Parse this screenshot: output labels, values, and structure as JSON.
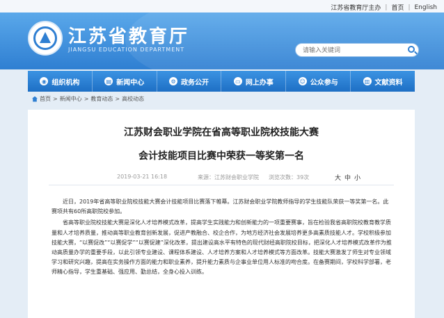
{
  "topbar": {
    "sponsor": "江苏省教育厅主办",
    "home": "首页",
    "english": "English"
  },
  "header": {
    "title": "江苏省教育厅",
    "subtitle": "JIANGSU EDUCATION DEPARTMENT",
    "search_placeholder": "请输入关键词"
  },
  "nav": [
    {
      "label": "组织机构",
      "icon": "org-icon"
    },
    {
      "label": "新闻中心",
      "icon": "news-icon"
    },
    {
      "label": "政务公开",
      "icon": "gov-icon"
    },
    {
      "label": "网上办事",
      "icon": "monitor-icon"
    },
    {
      "label": "公众参与",
      "icon": "people-icon"
    },
    {
      "label": "文献资料",
      "icon": "book-icon"
    }
  ],
  "breadcrumb": {
    "items": [
      "首页",
      "新闻中心",
      "教育动态",
      "高校动态"
    ],
    "sep": ">"
  },
  "article": {
    "title_line1": "江苏财会职业学院在省高等职业院校技能大赛",
    "title_line2": "会计技能项目比赛中荣获一等奖第一名",
    "date": "2019-03-21 16:18",
    "source": "来源：江苏财会职业学院",
    "views": "浏览次数：39次",
    "font_sizes": [
      "大",
      "中",
      "小"
    ],
    "paragraphs": [
      "近日，2019年省高等职业院校技能大赛会计技能项目比赛落下帷幕。江苏财会职业学院教师指导的学生技能队荣获一等奖第一名。此赛项共有60所高职院校参加。",
      "省高等职业院校技能大赛是深化人才培养模式改革，提高学生实践能力和创新能力的一项重要赛事，旨在检验我省高职院校教育教学质量和人才培养质量，推动高等职业教育创新发展，促进产教融合、校企合作，为地方经济社会发展培养更多高素质技能人才。学校积极参加技能大赛，“以赛促改”“以赛促学”“以赛促建”深化改革，提出建设高水平有特色的现代财经高职院校目标，把深化人才培养模式改革作为推动高质量办学的重要手段，以此引领专业建设、课程体系建设、人才培养方案和人才培养模式等方面改革。技能大赛激发了师生对专业领域学习和研究兴趣，提高在实务操作方面的能力和职业素养，提升能力素质与企事业单位用人标准的吻合度。在备赛期间，学校科学部署，老师精心指导，学生重基础、强应用、勤总结，全身心投入训练。"
    ]
  }
}
